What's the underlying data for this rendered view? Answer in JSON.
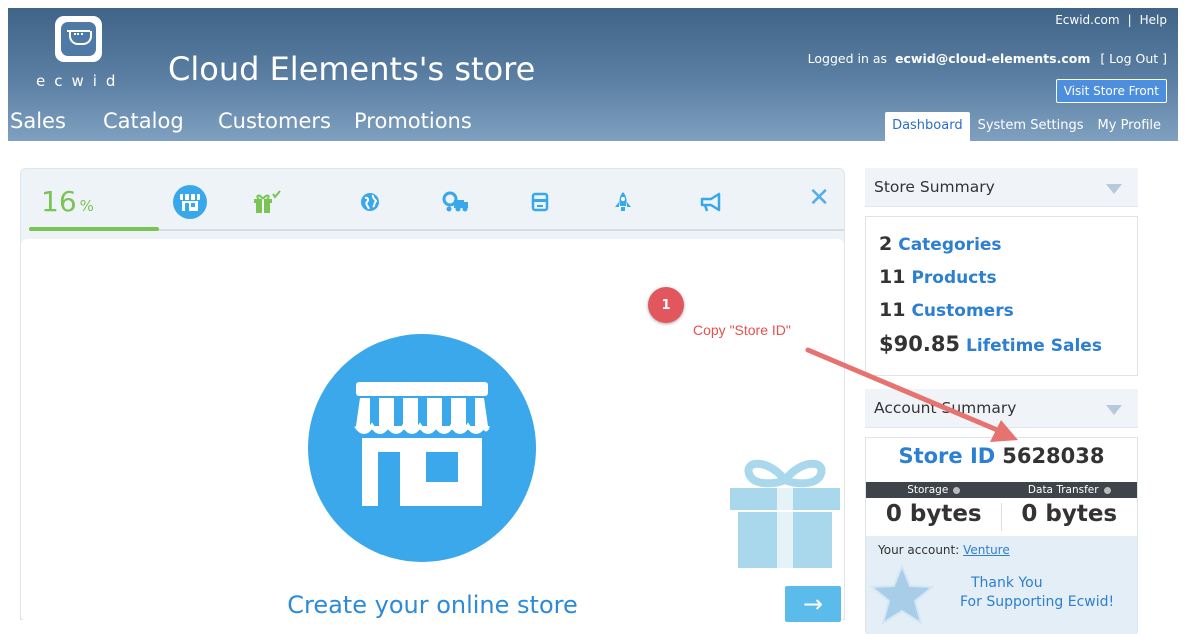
{
  "header": {
    "logo_text": "ecwid",
    "store_title": "Cloud Elements's store",
    "top_links": [
      "Ecwid.com",
      "Help"
    ],
    "logged_in_label": "Logged in as",
    "email": "ecwid@cloud-elements.com",
    "logout_label": "[ Log Out ]",
    "visit_store_label": "Visit Store Front",
    "main_nav": [
      "Sales",
      "Catalog",
      "Customers",
      "Promotions"
    ],
    "sub_nav": [
      "Dashboard",
      "System Settings",
      "My Profile"
    ],
    "active_sub_nav": "Dashboard"
  },
  "progress": {
    "percent": "16",
    "percent_sign": "%",
    "progress_fraction": 0.16,
    "steps": [
      "shop-icon",
      "gift-icon",
      "globe-icon",
      "shipping-truck-icon",
      "credit-card-icon",
      "rocket-icon",
      "megaphone-icon"
    ],
    "close_label": "✕"
  },
  "main_card": {
    "create_label": "Create your online store",
    "next_label": "→"
  },
  "store_summary": {
    "title": "Store Summary",
    "rows": [
      {
        "num": "2",
        "label": "Categories"
      },
      {
        "num": "11",
        "label": "Products"
      },
      {
        "num": "11",
        "label": "Customers"
      },
      {
        "num": "$90.85",
        "label": "Lifetime Sales"
      }
    ]
  },
  "account_summary": {
    "title": "Account Summary",
    "store_id_label": "Store ID",
    "store_id": "5628038",
    "storage_label": "Storage",
    "transfer_label": "Data Transfer",
    "storage_value": "0 bytes",
    "transfer_value": "0 bytes",
    "your_account_label": "Your account:",
    "plan": "Venture",
    "thanks_line1": "Thank You",
    "thanks_line2": "For Supporting Ecwid!"
  },
  "annotation": {
    "badge": "1",
    "note": "Copy \"Store ID\""
  },
  "colors": {
    "header_top": "#3f6487",
    "accent_blue": "#3aa8ea",
    "link_blue": "#2c7fd1",
    "progress_green": "#79c455",
    "annotation_red": "#e2575d"
  }
}
